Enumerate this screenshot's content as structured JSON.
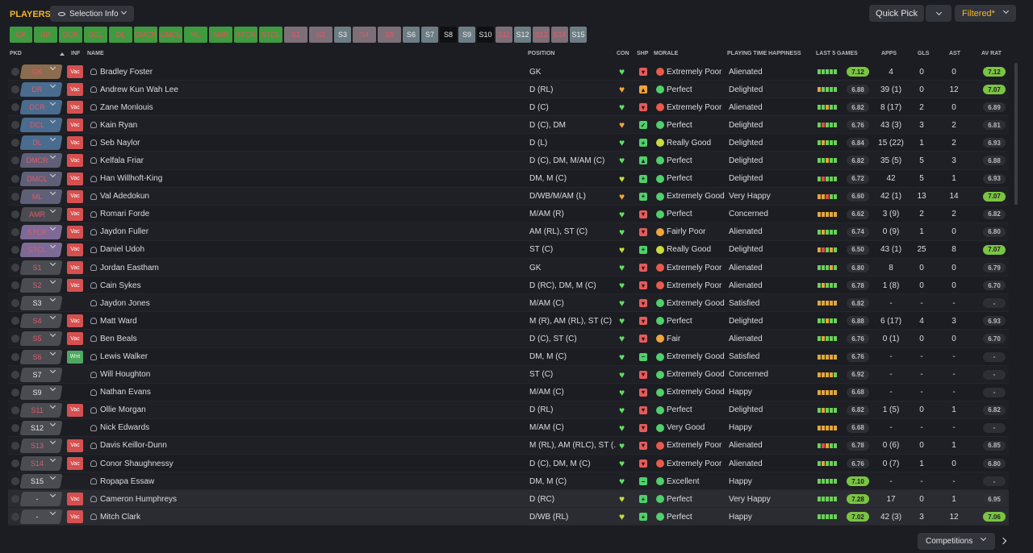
{
  "header": {
    "title": "PLAYERS",
    "selection_info_label": "Selection Info",
    "quick_pick_label": "Quick Pick",
    "filtered_label": "Filtered*",
    "competitions_label": "Competitions"
  },
  "position_buttons": [
    {
      "label": "GK",
      "style": "green"
    },
    {
      "label": "DR",
      "style": "green"
    },
    {
      "label": "DCR",
      "style": "green"
    },
    {
      "label": "DCL",
      "style": "green"
    },
    {
      "label": "DL",
      "style": "green"
    },
    {
      "label": "DMCR",
      "style": "green"
    },
    {
      "label": "DMCL",
      "style": "green"
    },
    {
      "label": "ML",
      "style": "green"
    },
    {
      "label": "AMR",
      "style": "green"
    },
    {
      "label": "STCR",
      "style": "green"
    },
    {
      "label": "STCL",
      "style": "green"
    },
    {
      "label": "S1",
      "style": "red"
    },
    {
      "label": "S2",
      "style": "red"
    },
    {
      "label": "S3",
      "style": "grey"
    },
    {
      "label": "S4",
      "style": "red"
    },
    {
      "label": "S5",
      "style": "red"
    },
    {
      "label": "S6",
      "style": "grey"
    },
    {
      "label": "S7",
      "style": "grey"
    },
    {
      "label": "S8",
      "style": "black"
    },
    {
      "label": "S9",
      "style": "grey"
    },
    {
      "label": "S10",
      "style": "black"
    },
    {
      "label": "S11",
      "style": "red"
    },
    {
      "label": "S12",
      "style": "grey"
    },
    {
      "label": "S13",
      "style": "red"
    },
    {
      "label": "S14",
      "style": "red"
    },
    {
      "label": "S15",
      "style": "grey"
    }
  ],
  "columns": {
    "pkd": "PKD",
    "inf": "INF",
    "name": "NAME",
    "position": "POSITION",
    "con": "CON",
    "shp": "SHP",
    "morale": "MORALE",
    "pth": "PLAYING TIME HAPPINESS",
    "last5": "LAST 5 GAMES",
    "apps": "APPS",
    "gls": "GLS",
    "ast": "AST",
    "avrat": "AV RAT"
  },
  "colors": {
    "accent": "#f2b82a",
    "vac": "#d65050",
    "wnt": "#4ea862",
    "rating_green": "#7bc442",
    "heart_green": "#5fe05f",
    "heart_yellow": "#c8dc3c",
    "heart_amber": "#f0a53c"
  },
  "players": [
    {
      "pkd": "GK",
      "pkd_color": "gk",
      "inf": "Vac",
      "name": "Bradley Foster",
      "position": "GK",
      "con": "green",
      "shp": "down-red",
      "morale_icon": "red",
      "morale": "Extremely Poor",
      "pth": "Alienated",
      "form": [
        "g",
        "g",
        "g",
        "g",
        "g"
      ],
      "last5": "7.12",
      "last5_hi": true,
      "apps": "4",
      "gls": "0",
      "ast": "0",
      "avrat": "7.12",
      "avrat_hi": true
    },
    {
      "pkd": "DR",
      "pkd_color": "def",
      "inf": "Vac",
      "name": "Andrew Kun Wah Lee",
      "position": "D (RL)",
      "con": "amber",
      "shp": "up-orange",
      "morale_icon": "green",
      "morale": "Perfect",
      "pth": "Delighted",
      "form": [
        "o",
        "g",
        "g",
        "g",
        "g"
      ],
      "last5": "6.88",
      "last5_hi": false,
      "apps": "39 (1)",
      "gls": "0",
      "ast": "12",
      "avrat": "7.07",
      "avrat_hi": true
    },
    {
      "pkd": "DCR",
      "pkd_color": "def",
      "inf": "Vac",
      "name": "Zane Monlouis",
      "position": "D (C)",
      "con": "green",
      "shp": "down-red",
      "morale_icon": "red",
      "morale": "Extremely Poor",
      "pth": "Alienated",
      "form": [
        "g",
        "g",
        "o",
        "g",
        "g"
      ],
      "last5": "6.82",
      "last5_hi": false,
      "apps": "8 (17)",
      "gls": "2",
      "ast": "0",
      "avrat": "6.89",
      "avrat_hi": false
    },
    {
      "pkd": "DCL",
      "pkd_color": "def",
      "inf": "Vac",
      "name": "Kain Ryan",
      "position": "D (C), DM",
      "con": "amber",
      "shp": "check-green",
      "morale_icon": "green",
      "morale": "Perfect",
      "pth": "Delighted",
      "form": [
        "g",
        "r",
        "g",
        "g",
        "g"
      ],
      "last5": "6.76",
      "last5_hi": false,
      "apps": "43 (3)",
      "gls": "3",
      "ast": "2",
      "avrat": "6.81",
      "avrat_hi": false
    },
    {
      "pkd": "DL",
      "pkd_color": "def",
      "inf": "Vac",
      "name": "Seb Naylor",
      "position": "D (L)",
      "con": "green",
      "shp": "plus-green",
      "morale_icon": "yellow",
      "morale": "Really Good",
      "pth": "Delighted",
      "form": [
        "g",
        "o",
        "g",
        "g",
        "g"
      ],
      "last5": "6.84",
      "last5_hi": false,
      "apps": "15 (22)",
      "gls": "1",
      "ast": "2",
      "avrat": "6.93",
      "avrat_hi": false
    },
    {
      "pkd": "DMCR",
      "pkd_color": "mid",
      "inf": "Vac",
      "name": "Kelfala Friar",
      "position": "D (C), DM, M/AM (C)",
      "con": "green",
      "shp": "up-green",
      "morale_icon": "green",
      "morale": "Perfect",
      "pth": "Delighted",
      "form": [
        "g",
        "g",
        "o",
        "g",
        "g"
      ],
      "last5": "6.82",
      "last5_hi": false,
      "apps": "35 (5)",
      "gls": "5",
      "ast": "3",
      "avrat": "6.88",
      "avrat_hi": false
    },
    {
      "pkd": "DMCL",
      "pkd_color": "mid",
      "inf": "Vac",
      "name": "Han Willhoft-King",
      "position": "DM, M (C)",
      "con": "yellow",
      "shp": "plus-green",
      "morale_icon": "green",
      "morale": "Perfect",
      "pth": "Delighted",
      "form": [
        "g",
        "r",
        "g",
        "g",
        "g"
      ],
      "last5": "6.72",
      "last5_hi": false,
      "apps": "42",
      "gls": "5",
      "ast": "1",
      "avrat": "6.93",
      "avrat_hi": false
    },
    {
      "pkd": "ML",
      "pkd_color": "mid",
      "inf": "Vac",
      "name": "Val Adedokun",
      "position": "D/WB/M/AM (L)",
      "con": "amber",
      "shp": "plus-green",
      "morale_icon": "green",
      "morale": "Extremely Good",
      "pth": "Very Happy",
      "form": [
        "o",
        "o",
        "r",
        "g",
        "g"
      ],
      "last5": "6.60",
      "last5_hi": false,
      "apps": "42 (1)",
      "gls": "13",
      "ast": "14",
      "avrat": "7.07",
      "avrat_hi": true
    },
    {
      "pkd": "AMR",
      "pkd_color": "none",
      "inf": "Vac",
      "name": "Romari Forde",
      "position": "M/AM (R)",
      "con": "green",
      "shp": "down-red",
      "morale_icon": "green",
      "morale": "Perfect",
      "pth": "Concerned",
      "form": [
        "o",
        "o",
        "o",
        "o",
        "o"
      ],
      "last5": "6.62",
      "last5_hi": false,
      "apps": "3 (9)",
      "gls": "2",
      "ast": "2",
      "avrat": "6.82",
      "avrat_hi": false
    },
    {
      "pkd": "STCR",
      "pkd_color": "att",
      "inf": "Vac",
      "name": "Jaydon Fuller",
      "position": "AM (RL), ST (C)",
      "con": "green",
      "shp": "down-red",
      "morale_icon": "orange",
      "morale": "Fairly Poor",
      "pth": "Alienated",
      "form": [
        "g",
        "o",
        "g",
        "g",
        "g"
      ],
      "last5": "6.74",
      "last5_hi": false,
      "apps": "0 (9)",
      "gls": "1",
      "ast": "0",
      "avrat": "6.80",
      "avrat_hi": false
    },
    {
      "pkd": "STCL",
      "pkd_color": "att",
      "inf": "Vac",
      "name": "Daniel Udoh",
      "position": "ST (C)",
      "con": "yellow",
      "shp": "plus-green",
      "morale_icon": "yellow",
      "morale": "Really Good",
      "pth": "Delighted",
      "form": [
        "o",
        "r",
        "g",
        "o",
        "g"
      ],
      "last5": "6.50",
      "last5_hi": false,
      "apps": "43 (1)",
      "gls": "25",
      "ast": "8",
      "avrat": "7.07",
      "avrat_hi": true
    },
    {
      "pkd": "S1",
      "pkd_color": "none",
      "inf": "Vac",
      "name": "Jordan Eastham",
      "position": "GK",
      "con": "green",
      "shp": "down-red",
      "morale_icon": "red",
      "morale": "Extremely Poor",
      "pth": "Alienated",
      "form": [
        "g",
        "g",
        "g",
        "o",
        "g"
      ],
      "last5": "6.80",
      "last5_hi": false,
      "apps": "8",
      "gls": "0",
      "ast": "0",
      "avrat": "6.79",
      "avrat_hi": false
    },
    {
      "pkd": "S2",
      "pkd_color": "none",
      "inf": "Vac",
      "name": "Cain Sykes",
      "position": "D (RC), DM, M (C)",
      "con": "green",
      "shp": "down-red",
      "morale_icon": "red",
      "morale": "Extremely Poor",
      "pth": "Alienated",
      "form": [
        "g",
        "o",
        "g",
        "g",
        "g"
      ],
      "last5": "6.78",
      "last5_hi": false,
      "apps": "1 (8)",
      "gls": "0",
      "ast": "0",
      "avrat": "6.70",
      "avrat_hi": false
    },
    {
      "pkd": "S3",
      "pkd_color": "none",
      "inf": "",
      "name": "Jaydon Jones",
      "position": "M/AM (C)",
      "con": "green",
      "shp": "down-red",
      "morale_icon": "green",
      "morale": "Extremely Good",
      "pth": "Satisfied",
      "form": [
        "o",
        "o",
        "o",
        "o",
        "o"
      ],
      "last5": "6.82",
      "last5_hi": false,
      "apps": "-",
      "gls": "-",
      "ast": "-",
      "avrat": "-",
      "avrat_hi": false
    },
    {
      "pkd": "S4",
      "pkd_color": "none",
      "inf": "Vac",
      "name": "Matt Ward",
      "position": "M (R), AM (RL), ST (C)",
      "con": "green",
      "shp": "down-red",
      "morale_icon": "green",
      "morale": "Perfect",
      "pth": "Delighted",
      "form": [
        "g",
        "g",
        "o",
        "g",
        "g"
      ],
      "last5": "6.88",
      "last5_hi": false,
      "apps": "6 (17)",
      "gls": "4",
      "ast": "3",
      "avrat": "6.93",
      "avrat_hi": false
    },
    {
      "pkd": "S5",
      "pkd_color": "none",
      "inf": "Vac",
      "name": "Ben Beals",
      "position": "D (C), ST (C)",
      "con": "green",
      "shp": "down-red",
      "morale_icon": "orange",
      "morale": "Fair",
      "pth": "Alienated",
      "form": [
        "g",
        "o",
        "g",
        "g",
        "g"
      ],
      "last5": "6.76",
      "last5_hi": false,
      "apps": "0 (1)",
      "gls": "0",
      "ast": "0",
      "avrat": "6.70",
      "avrat_hi": false
    },
    {
      "pkd": "S6",
      "pkd_color": "none",
      "inf": "Wnt",
      "name": "Lewis Walker",
      "position": "DM, M (C)",
      "con": "green",
      "shp": "minus-green",
      "morale_icon": "green",
      "morale": "Extremely Good",
      "pth": "Satisfied",
      "form": [
        "o",
        "o",
        "o",
        "o",
        "o"
      ],
      "last5": "6.76",
      "last5_hi": false,
      "apps": "-",
      "gls": "-",
      "ast": "-",
      "avrat": "-",
      "avrat_hi": false
    },
    {
      "pkd": "S7",
      "pkd_color": "none",
      "inf": "",
      "name": "Will Houghton",
      "position": "ST (C)",
      "con": "green",
      "shp": "down-red",
      "morale_icon": "green",
      "morale": "Extremely Good",
      "pth": "Concerned",
      "form": [
        "o",
        "o",
        "o",
        "o",
        "g"
      ],
      "last5": "6.92",
      "last5_hi": false,
      "apps": "-",
      "gls": "-",
      "ast": "-",
      "avrat": "-",
      "avrat_hi": false
    },
    {
      "pkd": "S9",
      "pkd_color": "none",
      "inf": "",
      "name": "Nathan Evans",
      "position": "M/AM (C)",
      "con": "green",
      "shp": "down-red",
      "morale_icon": "green",
      "morale": "Extremely Good",
      "pth": "Happy",
      "form": [
        "o",
        "o",
        "o",
        "o",
        "o"
      ],
      "last5": "6.68",
      "last5_hi": false,
      "apps": "-",
      "gls": "-",
      "ast": "-",
      "avrat": "-",
      "avrat_hi": false
    },
    {
      "pkd": "S11",
      "pkd_color": "none",
      "inf": "Vac",
      "name": "Ollie Morgan",
      "position": "D (RL)",
      "con": "green",
      "shp": "down-red",
      "morale_icon": "green",
      "morale": "Perfect",
      "pth": "Delighted",
      "form": [
        "g",
        "o",
        "g",
        "g",
        "g"
      ],
      "last5": "6.82",
      "last5_hi": false,
      "apps": "1 (5)",
      "gls": "0",
      "ast": "1",
      "avrat": "6.82",
      "avrat_hi": false
    },
    {
      "pkd": "S12",
      "pkd_color": "none",
      "inf": "",
      "name": "Nick Edwards",
      "position": "M/AM (C)",
      "con": "green",
      "shp": "down-red",
      "morale_icon": "green",
      "morale": "Very Good",
      "pth": "Happy",
      "form": [
        "o",
        "o",
        "o",
        "o",
        "o"
      ],
      "last5": "6.68",
      "last5_hi": false,
      "apps": "-",
      "gls": "-",
      "ast": "-",
      "avrat": "-",
      "avrat_hi": false
    },
    {
      "pkd": "S13",
      "pkd_color": "none",
      "inf": "Vac",
      "name": "Davis Keillor-Dunn",
      "position": "M (RL), AM (RLC), ST (...",
      "con": "green",
      "shp": "down-red",
      "morale_icon": "red",
      "morale": "Extremely Poor",
      "pth": "Alienated",
      "form": [
        "g",
        "r",
        "o",
        "g",
        "g"
      ],
      "last5": "6.78",
      "last5_hi": false,
      "apps": "0 (6)",
      "gls": "0",
      "ast": "1",
      "avrat": "6.85",
      "avrat_hi": false
    },
    {
      "pkd": "S14",
      "pkd_color": "none",
      "inf": "Vac",
      "name": "Conor Shaughnessy",
      "position": "D (C), DM, M (C)",
      "con": "green",
      "shp": "down-red",
      "morale_icon": "red",
      "morale": "Extremely Poor",
      "pth": "Alienated",
      "form": [
        "g",
        "o",
        "g",
        "g",
        "g"
      ],
      "last5": "6.76",
      "last5_hi": false,
      "apps": "0 (7)",
      "gls": "1",
      "ast": "0",
      "avrat": "6.80",
      "avrat_hi": false
    },
    {
      "pkd": "S15",
      "pkd_color": "none",
      "inf": "",
      "name": "Ropapa Essaw",
      "position": "DM, M (C)",
      "con": "green",
      "shp": "minus-green",
      "morale_icon": "green",
      "morale": "Excellent",
      "pth": "Happy",
      "form": [
        "g",
        "g",
        "g",
        "g",
        "g"
      ],
      "last5": "7.10",
      "last5_hi": true,
      "apps": "-",
      "gls": "-",
      "ast": "-",
      "avrat": "-",
      "avrat_hi": false
    },
    {
      "pkd": "-",
      "pkd_color": "none",
      "inf": "Vac",
      "name": "Cameron Humphreys",
      "position": "D (RC)",
      "con": "yellow",
      "shp": "plus-green",
      "morale_icon": "green",
      "morale": "Perfect",
      "pth": "Very Happy",
      "form": [
        "g",
        "g",
        "g",
        "g",
        "g"
      ],
      "last5": "7.28",
      "last5_hi": true,
      "apps": "17",
      "gls": "0",
      "ast": "1",
      "avrat": "6.95",
      "avrat_hi": false
    },
    {
      "pkd": "-",
      "pkd_color": "none",
      "inf": "Vac",
      "name": "Mitch Clark",
      "position": "D/WB (RL)",
      "con": "yellow",
      "shp": "plus-green",
      "morale_icon": "green",
      "morale": "Perfect",
      "pth": "Happy",
      "form": [
        "g",
        "g",
        "g",
        "g",
        "g"
      ],
      "last5": "7.02",
      "last5_hi": true,
      "apps": "42 (3)",
      "gls": "3",
      "ast": "12",
      "avrat": "7.06",
      "avrat_hi": true
    }
  ]
}
